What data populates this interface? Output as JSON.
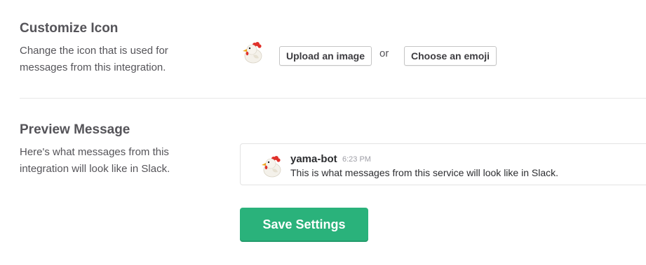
{
  "customize_icon": {
    "title": "Customize Icon",
    "description": "Change the icon that is used for messages from this integration.",
    "icon": "chicken-emoji",
    "upload_label": "Upload an image",
    "or_label": "or",
    "emoji_label": "Choose an emoji"
  },
  "preview": {
    "title": "Preview Message",
    "description": "Here's what messages from this integration will look like in Slack.",
    "bot_name": "yama-bot",
    "timestamp": "6:23 PM",
    "message": "This is what messages from this service will look like in Slack.",
    "avatar_icon": "chicken-emoji"
  },
  "save_label": "Save Settings",
  "colors": {
    "save_button": "#2ab27b",
    "heading": "#555459"
  }
}
